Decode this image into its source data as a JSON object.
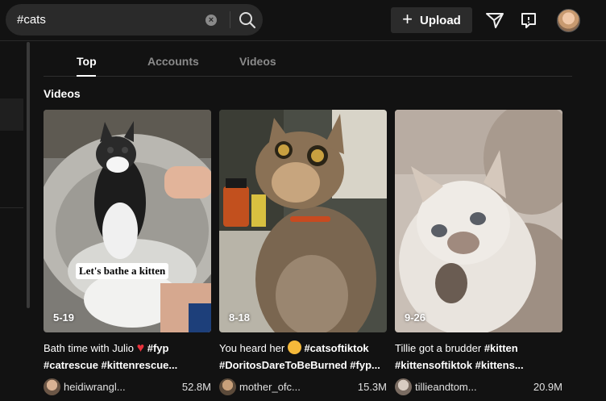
{
  "search": {
    "value": "#cats",
    "clear_icon": "close-circle-icon",
    "search_icon": "magnifier-icon"
  },
  "header": {
    "upload_label": "Upload",
    "upload_icon": "plus-icon",
    "send_icon": "paper-plane-icon",
    "inbox_icon": "message-icon"
  },
  "tabs": [
    {
      "label": "Top",
      "active": true
    },
    {
      "label": "Accounts",
      "active": false
    },
    {
      "label": "Videos",
      "active": false
    }
  ],
  "section_title": "Videos",
  "videos": [
    {
      "duration": "5-19",
      "overlay": "Let's bathe a kitten",
      "caption_line1_text": "Bath time with Julio ",
      "caption_line1_tag": "#fyp",
      "caption_line2": "#catrescue #kittenrescue...",
      "username": "heidiwrangl...",
      "views": "52.8M"
    },
    {
      "duration": "8-18",
      "caption_line1_text": "You heard her ",
      "caption_line1_tag": "#catsoftiktok",
      "caption_line2": "#DoritosDareToBeBurned #fyp...",
      "username": "mother_ofc...",
      "views": "15.3M"
    },
    {
      "duration": "9-26",
      "caption_line1_text": "Tillie got a brudder ",
      "caption_line1_tag": "#kitten",
      "caption_line2": "#kittensoftiktok #kittens...",
      "username": "tillieandtom...",
      "views": "20.9M"
    }
  ]
}
